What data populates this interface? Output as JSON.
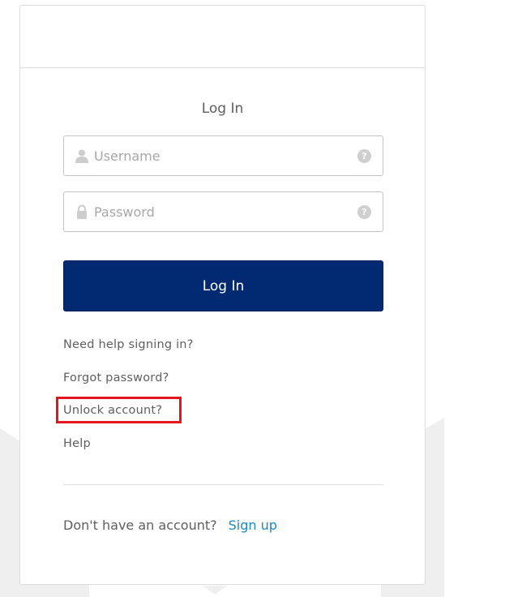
{
  "login": {
    "title": "Log In",
    "username_placeholder": "Username",
    "password_placeholder": "Password",
    "help_glyph": "?",
    "submit_label": "Log In"
  },
  "links": {
    "need_help": "Need help signing in?",
    "forgot_password": "Forgot password?",
    "unlock_account": "Unlock account?",
    "help": "Help"
  },
  "signup": {
    "prompt": "Don't have an account?",
    "link_label": "Sign up"
  },
  "colors": {
    "primary_button": "#012a73",
    "link_accent": "#1a8ac4",
    "highlight_box": "#e3161f"
  },
  "icons": {
    "username": "user-icon",
    "password": "lock-icon",
    "field_help": "question-circle-icon"
  }
}
